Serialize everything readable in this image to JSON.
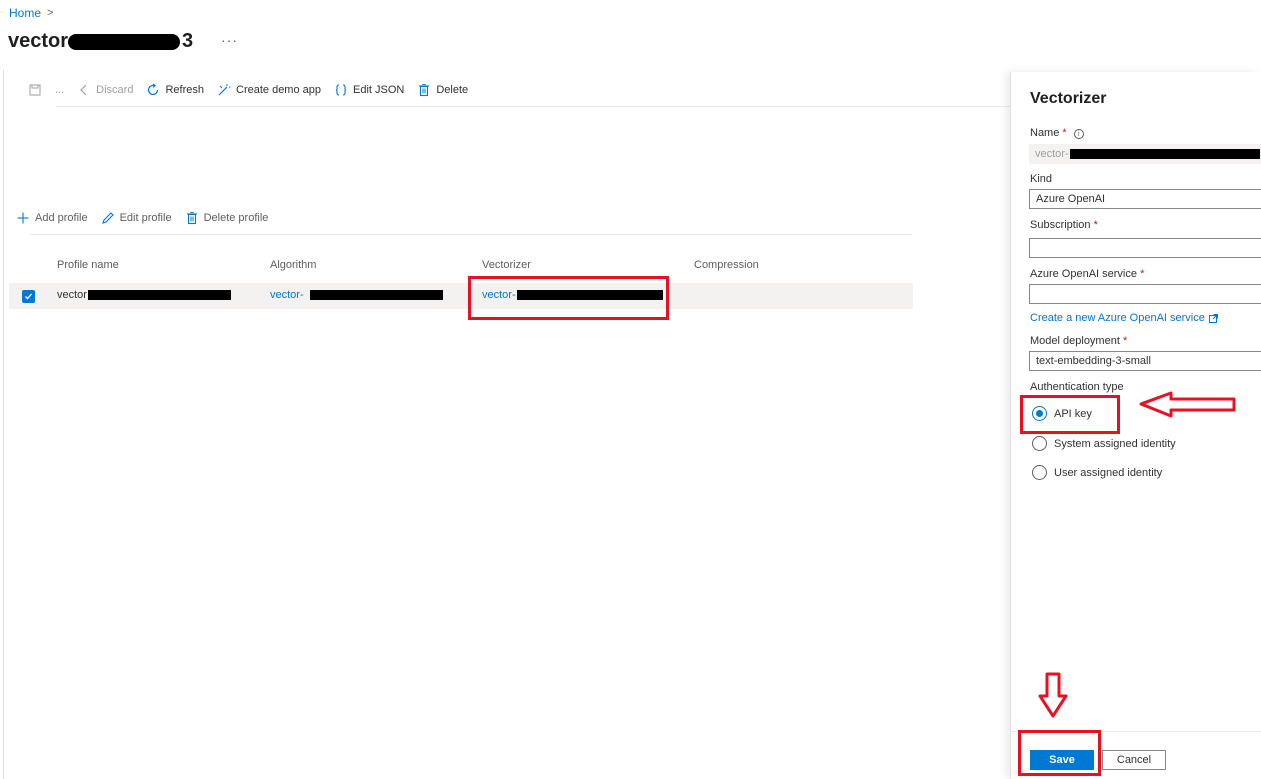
{
  "breadcrumb": {
    "home": "Home",
    "separator": ">"
  },
  "title": {
    "prefix": "vector",
    "suffix": "3",
    "more": "···"
  },
  "toolbar": {
    "more": "...",
    "discard": "Discard",
    "refresh": "Refresh",
    "create_demo_app": "Create demo app",
    "edit_json": "Edit JSON",
    "delete": "Delete"
  },
  "profile_toolbar": {
    "add": "Add profile",
    "edit": "Edit profile",
    "delete": "Delete profile"
  },
  "table": {
    "headers": [
      "Profile name",
      "Algorithm",
      "Vectorizer",
      "Compression"
    ],
    "rows": [
      {
        "profile_name": "vector",
        "algorithm": "vector-",
        "vectorizer": "vector-",
        "compression": ""
      }
    ]
  },
  "panel": {
    "title": "Vectorizer",
    "name_label": "Name",
    "name_value": "vector-",
    "kind_label": "Kind",
    "kind_value": "Azure OpenAI",
    "subscription_label": "Subscription",
    "subscription_value": "",
    "service_label": "Azure OpenAI service",
    "service_value": "",
    "create_link": "Create a new Azure OpenAI service",
    "deployment_label": "Model deployment",
    "deployment_value": "text-embedding-3-small",
    "auth_label": "Authentication type",
    "auth_options": [
      "API key",
      "System assigned identity",
      "User assigned identity"
    ],
    "auth_selected": "API key",
    "save": "Save",
    "cancel": "Cancel"
  },
  "colors": {
    "accent": "#0078d4",
    "highlight": "#e81123"
  }
}
